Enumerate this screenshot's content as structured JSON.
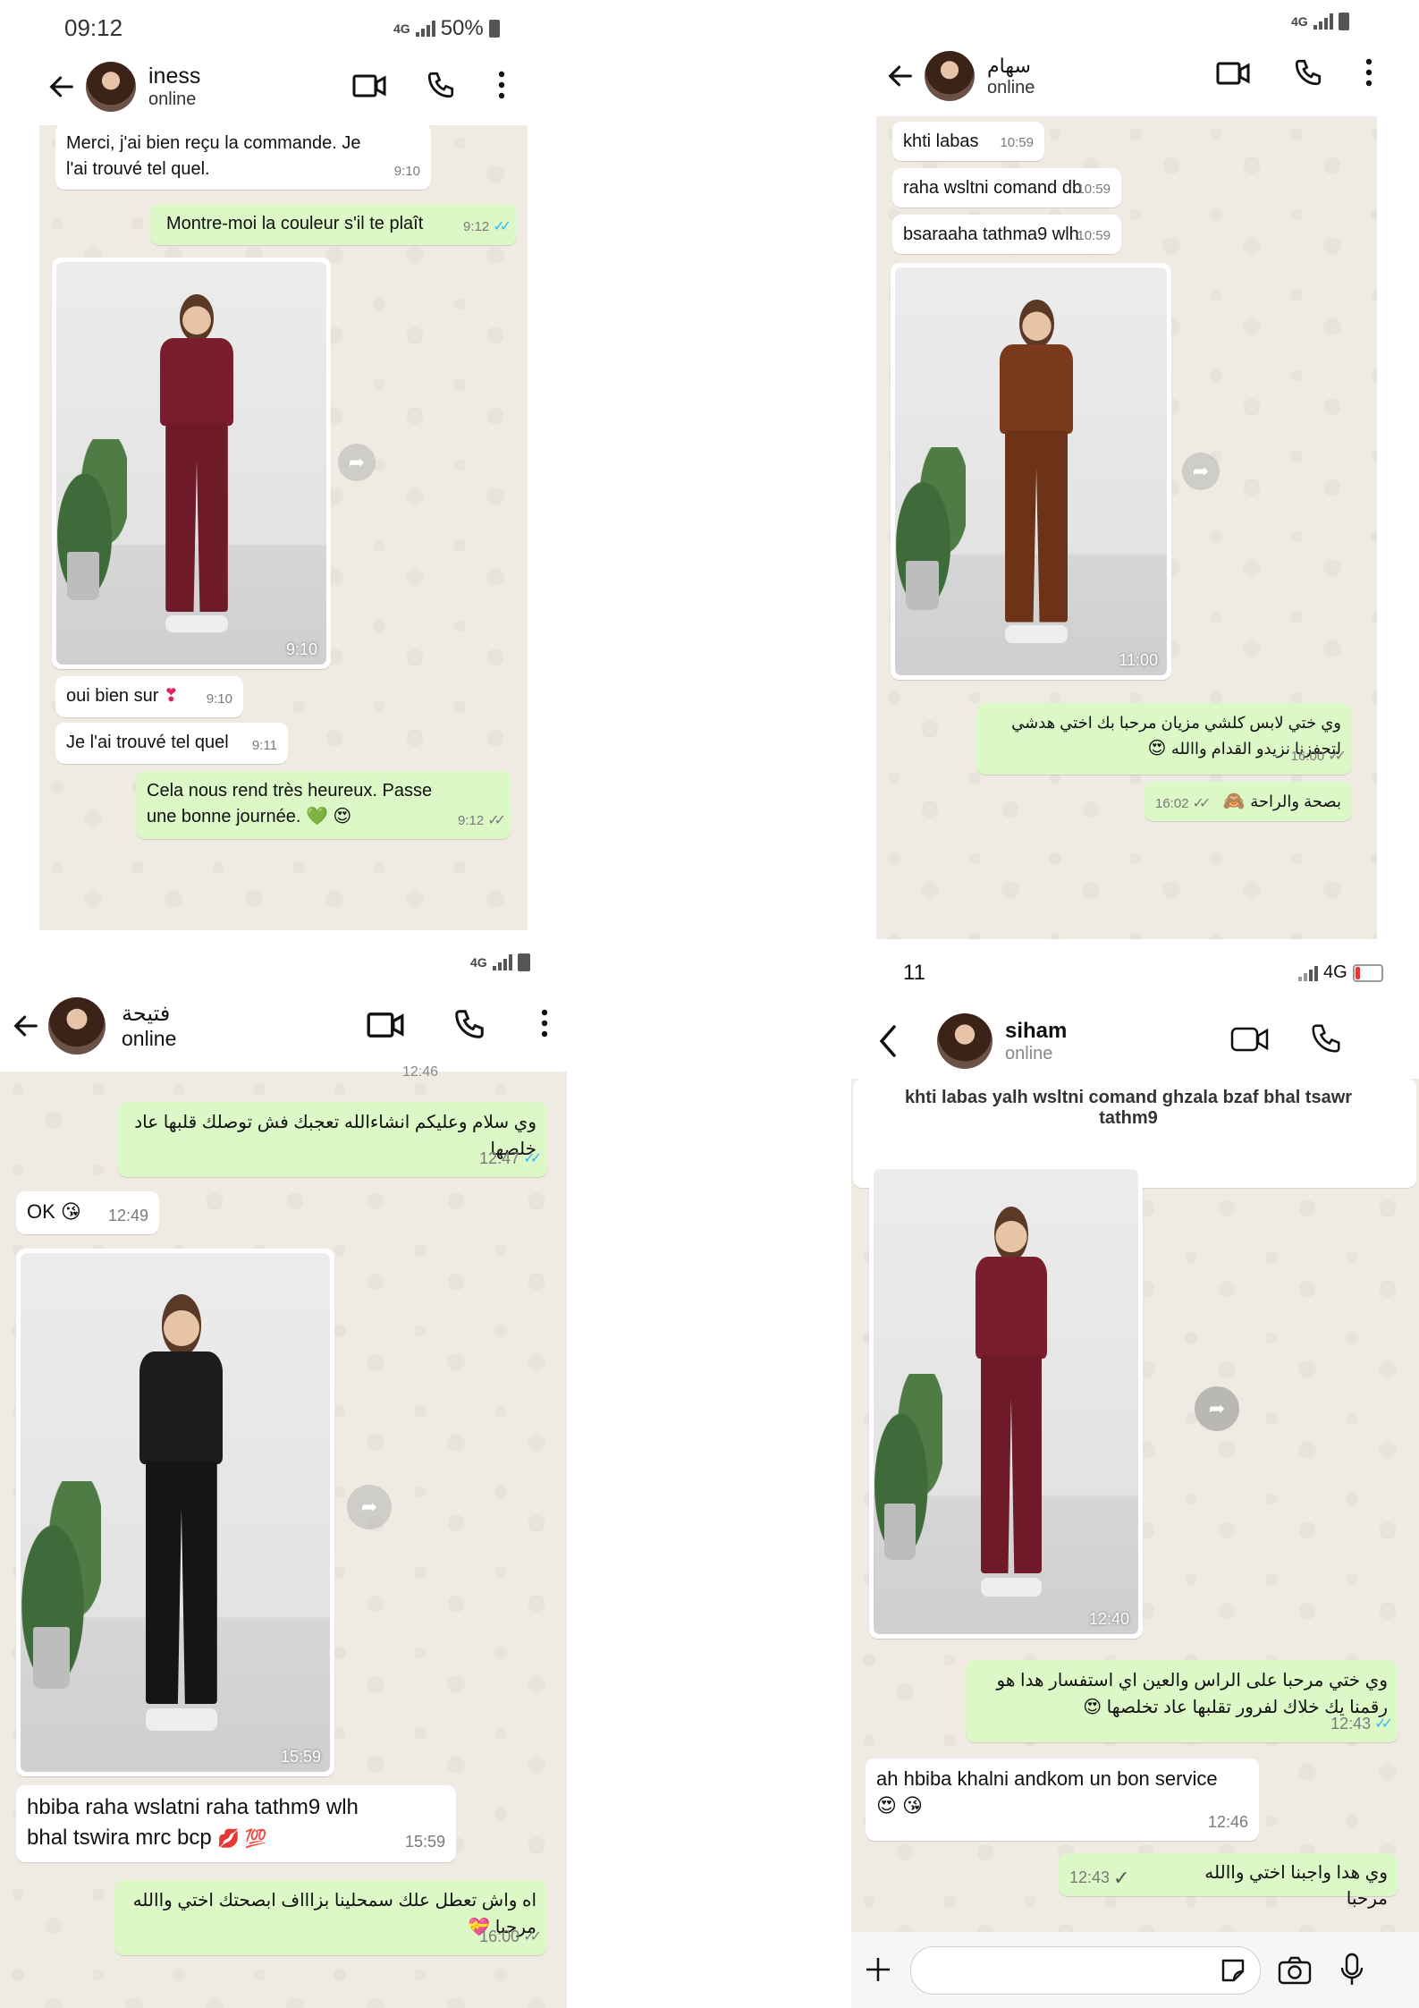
{
  "panel1": {
    "status_time": "09:12",
    "status_net": "4G",
    "status_batt": "50%",
    "contact_name": "iness",
    "contact_status": "online",
    "messages": [
      {
        "text": "Merci, j'ai bien reçu la commande. Je l'ai trouvé tel quel.",
        "time": "9:10"
      },
      {
        "text": "Montre-moi la couleur s'il te plaît",
        "time": "9:12"
      },
      {
        "photo_time": "9:10"
      },
      {
        "text": "oui bien sur",
        "emoji": "❣",
        "time": "9:10"
      },
      {
        "text": "Je l'ai trouvé tel quel",
        "time": "9:11"
      },
      {
        "text": "Cela nous rend très heureux. Passe une bonne journée.",
        "emoji": "💚 😍",
        "time": "9:12"
      }
    ],
    "photo_colors": {
      "top": "#7a1e2e",
      "pants": "#6e1a29"
    }
  },
  "panel2": {
    "status_net": "4G",
    "contact_name": "سهام",
    "contact_status": "online",
    "messages": [
      {
        "text": "khti labas",
        "time": "10:59"
      },
      {
        "text": "raha wsltni comand db",
        "time": "10:59"
      },
      {
        "text": "bsaraaha tathma9 wlh",
        "time": "10:59"
      },
      {
        "photo_time": "11:00"
      },
      {
        "text": "وي ختي لابس كلشي مزيان مرحبا بك اختي هدشي لتحفزنا نزيدو القدام واالله",
        "emoji": "😍",
        "time": "16:00"
      },
      {
        "text": "بصحة والراحة",
        "emoji": "🙈",
        "time": "16:02"
      }
    ],
    "photo_colors": {
      "top": "#7c3a1c",
      "pants": "#6d3318"
    }
  },
  "panel3": {
    "status_net": "4G",
    "contact_name": "فتيحة",
    "contact_status": "online",
    "cut_time": "12:46",
    "messages": [
      {
        "text": "وي سلام وعليكم انشاءالله تعجبك فش توصلك قلبها عاد خلصها",
        "time": "12:47"
      },
      {
        "text": "OK",
        "emoji": "😘",
        "time": "12:49"
      },
      {
        "photo_time": "15:59"
      },
      {
        "text": "hbiba raha wslatni raha tathm9 wlh bhal tswira mrc bcp",
        "emoji": "💋 💯",
        "time": "15:59"
      },
      {
        "text": "اه واش تعطل علك سمحلينا بزاااف ابصحتك اختي واالله مرحبا",
        "emoji": "💝",
        "time": "16:00"
      }
    ],
    "photo_colors": {
      "top": "#1c1c1c",
      "pants": "#151515"
    }
  },
  "panel4": {
    "status_time": "11",
    "status_net": "4G",
    "contact_name": "siham",
    "contact_status": "online",
    "banner": "khti labas yalh wsltni comand ghzala bzaf bhal tsawr tathm9",
    "messages": [
      {
        "photo_time": "12:40"
      },
      {
        "text": "وي ختي مرحبا على الراس والعين اي استفسار هدا هو رقمنا يك خلاك لفرور تقلبها عاد تخلصها",
        "emoji": "😍",
        "time": "12:43"
      },
      {
        "text": "ah hbiba khalni andkom un bon service",
        "emoji": "😍 😘",
        "time": "12:46"
      },
      {
        "text": "وي هدا واجبنا اختي واالله مرحبا",
        "time": "12:43"
      }
    ],
    "photo_colors": {
      "top": "#7a1e2e",
      "pants": "#6e1a29"
    }
  },
  "colors": {
    "in_bubble": "#ffffff",
    "out_bubble": "#dcf8c6",
    "read_tick": "#34b7f1",
    "chat_bg": "#efeae2"
  },
  "icons": [
    "back-arrow-icon",
    "video-call-icon",
    "phone-icon",
    "more-options-icon",
    "forward-icon",
    "plus-icon",
    "sticker-icon",
    "camera-icon",
    "microphone-icon"
  ]
}
